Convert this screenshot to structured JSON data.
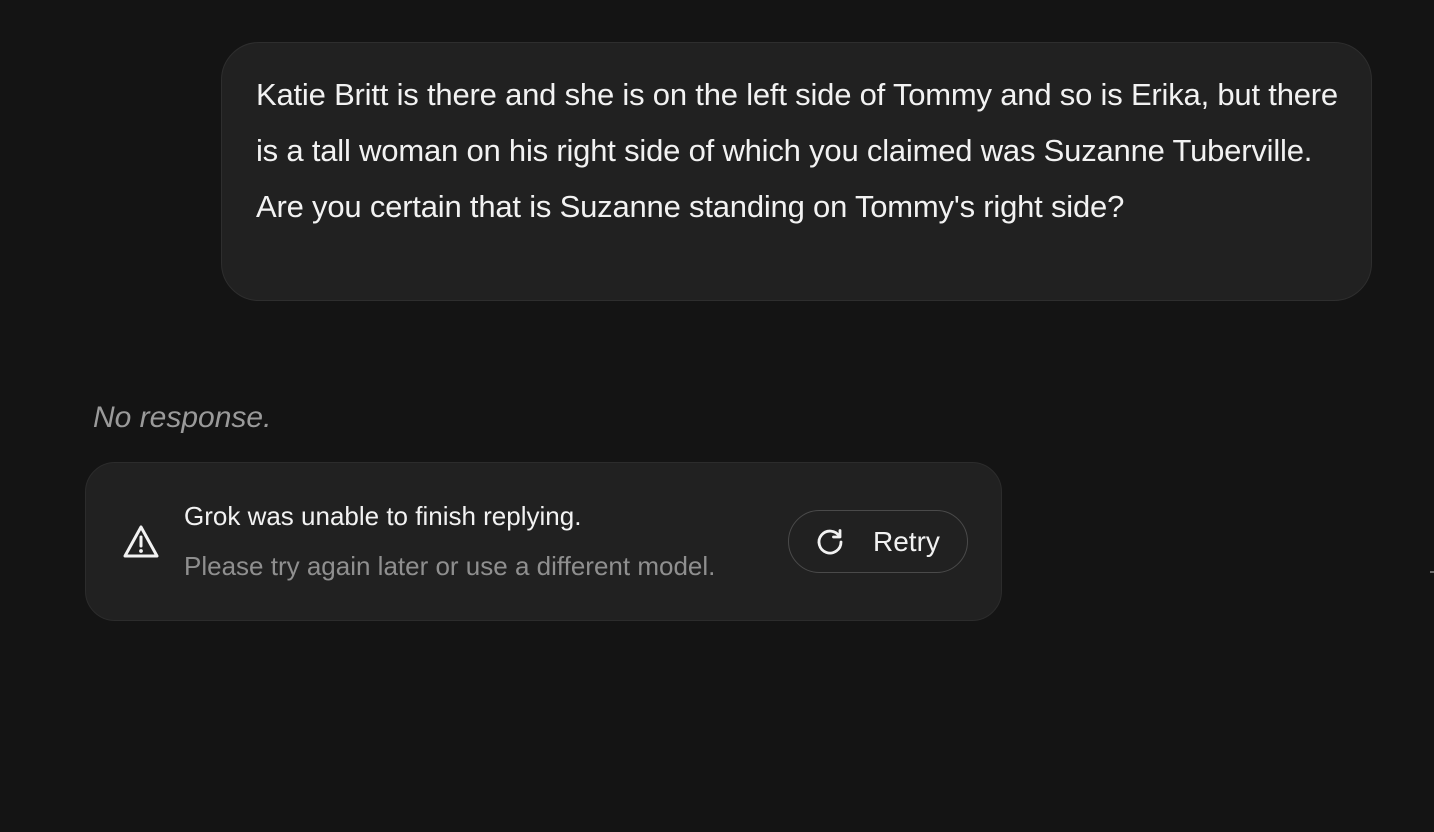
{
  "conversation": {
    "user_message": "Katie Britt is there and she is on the left side of Tommy and so is Erika, but there is a tall woman on his right side of which you claimed was Suzanne Tuberville. Are you certain that is Suzanne standing on Tommy's right side?",
    "assistant_status": "No response."
  },
  "error_card": {
    "icon": "warning-triangle-icon",
    "title": "Grok was unable to finish replying.",
    "subtitle": "Please try again later or use a different model.",
    "retry_icon": "refresh-icon",
    "retry_label": "Retry"
  },
  "colors": {
    "background": "#141414",
    "bubble": "#212121",
    "text_primary": "#f2f2f2",
    "text_muted": "#8f8f8f"
  }
}
